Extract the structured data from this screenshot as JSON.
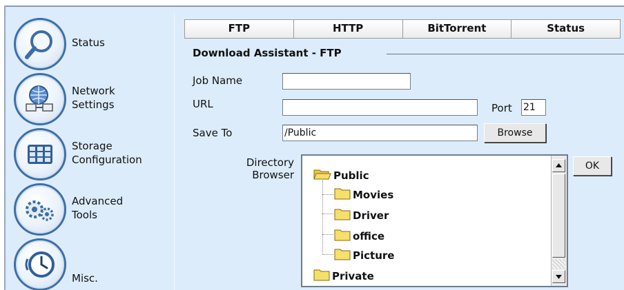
{
  "sidebar": {
    "items": [
      {
        "label": "Status",
        "icon": "magnifier-icon"
      },
      {
        "label": "Network\nSettings",
        "icon": "network-globe-icon"
      },
      {
        "label": "Storage\nConfiguration",
        "icon": "storage-grid-icon"
      },
      {
        "label": "Advanced\nTools",
        "icon": "gears-icon"
      },
      {
        "label": "Misc.",
        "icon": "clock-icon"
      }
    ]
  },
  "tabs": [
    {
      "label": "FTP"
    },
    {
      "label": "HTTP"
    },
    {
      "label": "BitTorrent"
    },
    {
      "label": "Status"
    }
  ],
  "section_title": "Download Assistant - FTP",
  "form": {
    "job_name_label": "Job Name",
    "job_name_value": "",
    "url_label": "URL",
    "url_value": "",
    "port_label": "Port",
    "port_value": "21",
    "save_to_label": "Save To",
    "save_to_value": "/Public",
    "browse_label": "Browse",
    "directory_label": "Directory\nBrowser",
    "ok_label": "OK"
  },
  "tree": {
    "root": "Public",
    "children": [
      "Movies",
      "Driver",
      "office",
      "Picture"
    ],
    "sibling": "Private"
  },
  "colors": {
    "background": "#dcecfb",
    "nav_ring": "#3e6fa6",
    "folder": "#f6df6a"
  }
}
